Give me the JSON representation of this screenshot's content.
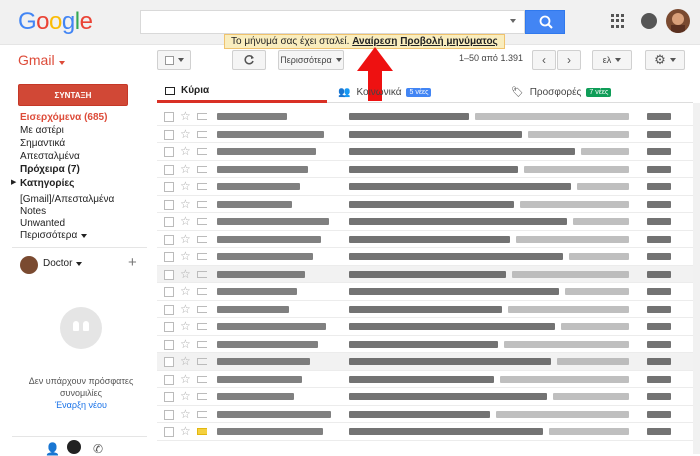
{
  "brand": {
    "letters": [
      "G",
      "o",
      "o",
      "g",
      "l",
      "e"
    ],
    "colors": [
      "#4285f4",
      "#ea4335",
      "#fbbc05",
      "#4285f4",
      "#34a853",
      "#ea4335"
    ]
  },
  "search": {
    "placeholder": "",
    "value": ""
  },
  "header": {
    "apps_icon": "apps-grid-icon",
    "bell_icon": "notifications-icon",
    "avatar_icon": "account-avatar"
  },
  "toolbar": {
    "gmail_label": "Gmail",
    "more_label": "Περισσότερα",
    "counter": "1–50 από 1.391",
    "lang_label": "ελ"
  },
  "notice": {
    "text": "Το μήνυμά σας έχει σταλεί.",
    "undo": "Αναίρεση",
    "view": "Προβολή μηνύματος"
  },
  "sidebar": {
    "compose": "ΣΥΝΤΑΞΗ",
    "inbox": "Εισερχόμενα (685)",
    "items": [
      "Με αστέρι",
      "Σημαντικά",
      "Απεσταλμένα",
      "Πρόχειρα (7)",
      "Κατηγορίες",
      "[Gmail]/Απεσταλμένα",
      "Notes",
      "Unwanted",
      "Περισσότερα"
    ],
    "hangout_user": "Doctor",
    "no_chats": "Δεν υπάρχουν πρόσφατες συνομιλίες",
    "start_new": "Έναρξη νέου"
  },
  "tabs": [
    {
      "label": "Κύρια",
      "badge": ""
    },
    {
      "label": "Κοινωνικά",
      "badge": "5 νέες",
      "badge_color": "#4285f4"
    },
    {
      "label": "Προσφορές",
      "badge": "7 νέες",
      "badge_color": "#0f9d58"
    }
  ]
}
